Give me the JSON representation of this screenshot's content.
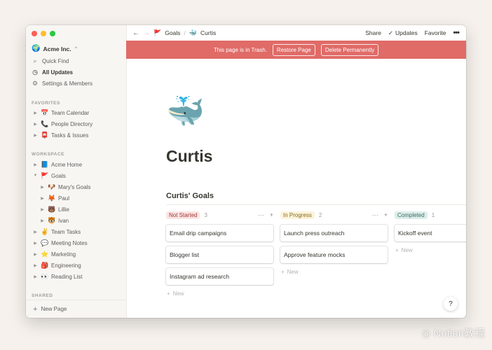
{
  "sidebar": {
    "workspace": "Acme Inc.",
    "nav": [
      {
        "icon": "search-icon",
        "glyph": "⌕",
        "label": "Quick Find"
      },
      {
        "icon": "clock-icon",
        "glyph": "◷",
        "label": "All Updates"
      },
      {
        "icon": "gear-icon",
        "glyph": "⚙",
        "label": "Settings & Members"
      }
    ],
    "favorites_label": "FAVORITES",
    "favorites": [
      {
        "emoji": "📅",
        "label": "Team Calendar"
      },
      {
        "emoji": "📞",
        "label": "People Directory"
      },
      {
        "emoji": "📮",
        "label": "Tasks & Issues"
      }
    ],
    "workspace_label": "WORKSPACE",
    "workspace_items": [
      {
        "emoji": "📘",
        "label": "Acme Home"
      },
      {
        "emoji": "🚩",
        "label": "Goals"
      },
      {
        "emoji": "🐶",
        "label": "Mary's Goals"
      },
      {
        "emoji": "🦊",
        "label": "Paul"
      },
      {
        "emoji": "🐻",
        "label": "Lillie"
      },
      {
        "emoji": "🐯",
        "label": "Ivan"
      },
      {
        "emoji": "✌️",
        "label": "Team Tasks"
      },
      {
        "emoji": "💬",
        "label": "Meeting Notes"
      },
      {
        "emoji": "⭐",
        "label": "Marketing"
      },
      {
        "emoji": "🎒",
        "label": "Engineering"
      },
      {
        "emoji": "👀",
        "label": "Reading List"
      }
    ],
    "shared_label": "SHARED",
    "new_page": "New Page"
  },
  "topbar": {
    "crumb1": "Goals",
    "crumb1_emoji": "🚩",
    "crumb2": "Curtis",
    "crumb2_emoji": "🐳",
    "share": "Share",
    "updates": "Updates",
    "favorite": "Favorite"
  },
  "banner": {
    "text": "This page is in Trash.",
    "restore": "Restore Page",
    "delete": "Delete Permanently"
  },
  "page": {
    "icon": "🐳",
    "title": "Curtis",
    "board_title": "Curtis' Goals"
  },
  "board": {
    "new_label": "New",
    "columns": [
      {
        "tag": "Not Started",
        "count": "3",
        "tag_bg": "#fbe4e4",
        "tag_fg": "#a03b36",
        "cards": [
          "Email drip campaigns",
          "Blogger list",
          "Instagram ad research"
        ]
      },
      {
        "tag": "In Progress",
        "count": "2",
        "tag_bg": "#fbf3db",
        "tag_fg": "#8a6a1c",
        "cards": [
          "Launch press outreach",
          "Approve feature mocks"
        ]
      },
      {
        "tag": "Completed",
        "count": "1",
        "tag_bg": "#ddedea",
        "tag_fg": "#3b6b5e",
        "cards": [
          "Kickoff event"
        ]
      }
    ]
  },
  "help": "?",
  "watermark": "Notion教程",
  "colors": {
    "banner": "#e06b67",
    "sidebar": "#f7f6f3"
  }
}
